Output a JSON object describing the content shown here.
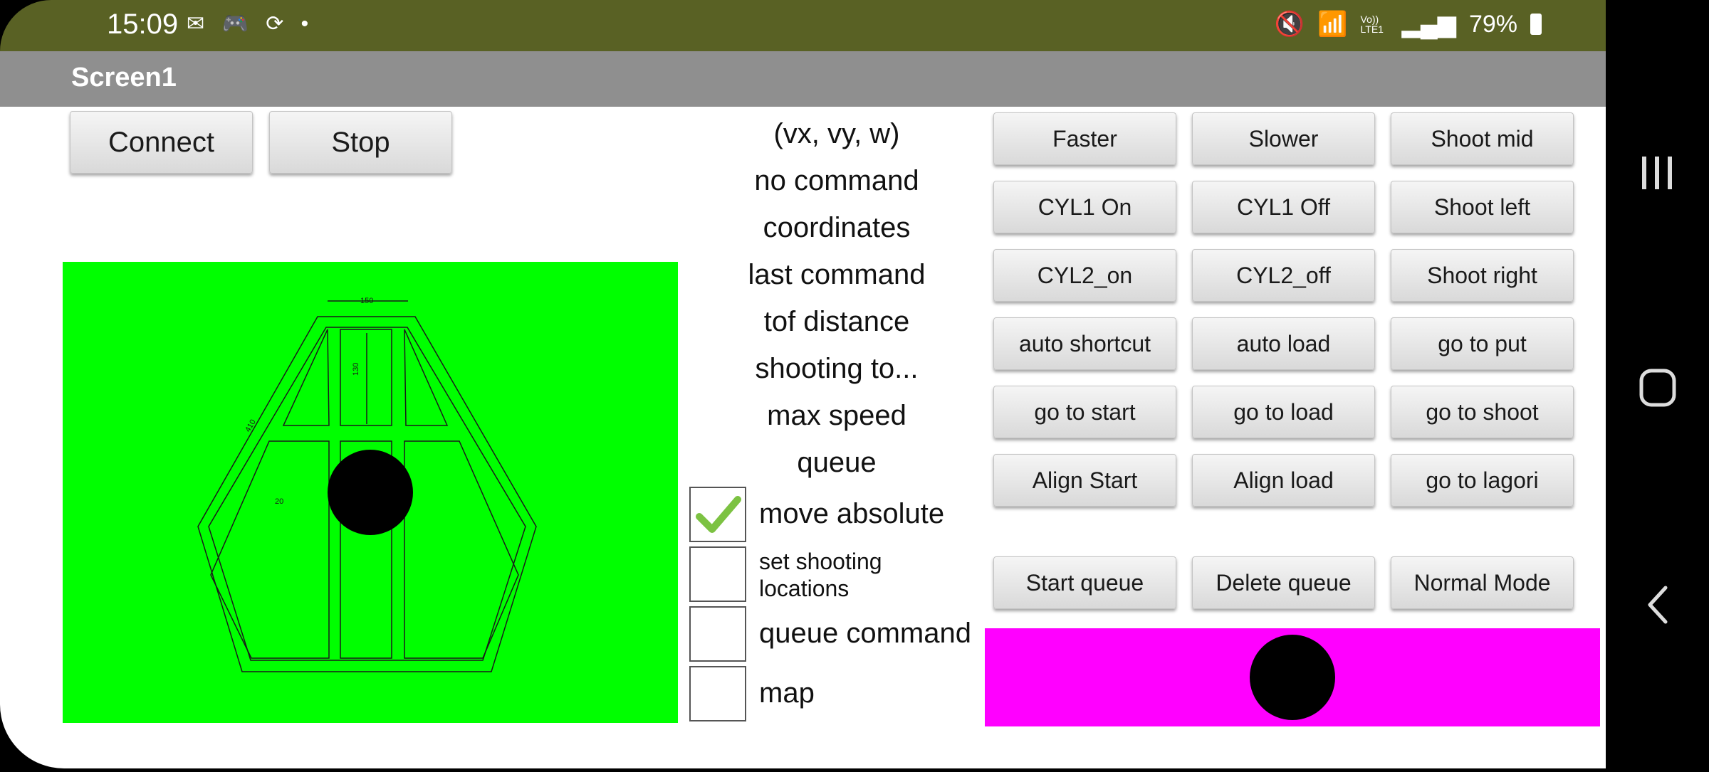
{
  "status_bar": {
    "time": "15:09",
    "left_icons": [
      "mail-icon",
      "game-icon",
      "sync-icon",
      "dot-icon"
    ],
    "right_icons": [
      "mute-icon",
      "wifi-icon",
      "volte-icon",
      "signal-icon"
    ],
    "volte_label": "Vo)) LTE1",
    "battery": "79%",
    "color": "#596124"
  },
  "app": {
    "title": "Screen1",
    "titlebar_color": "#8f8f8f"
  },
  "left_buttons": {
    "connect": "Connect",
    "stop": "Stop"
  },
  "center": {
    "labels": [
      "(vx, vy, w)",
      "no command",
      "coordinates",
      "last command",
      "tof distance",
      "shooting to...",
      "max speed",
      "queue"
    ],
    "checkboxes": [
      {
        "label": "move absolute",
        "checked": true
      },
      {
        "label": "set shooting locations",
        "checked": false
      },
      {
        "label": "queue command",
        "checked": false
      },
      {
        "label": "map",
        "checked": false
      }
    ]
  },
  "grid_buttons": [
    [
      "Faster",
      "Slower",
      "Shoot mid"
    ],
    [
      "CYL1 On",
      "CYL1 Off",
      "Shoot left"
    ],
    [
      "CYL2_on",
      "CYL2_off",
      "Shoot right"
    ],
    [
      "auto shortcut",
      "auto load",
      "go to put"
    ],
    [
      "go to start",
      "go to load",
      "go to shoot"
    ],
    [
      "Align Start",
      "Align load",
      "go to lagori"
    ]
  ],
  "queue_buttons": [
    "Start queue",
    "Delete queue",
    "Normal Mode"
  ],
  "map": {
    "background": "#00ff00",
    "dimension_labels": {
      "top": "150",
      "vertical": "130",
      "side": "410",
      "small": "20"
    }
  },
  "joystick": {
    "background": "#ff00ff"
  },
  "navigation": {
    "icons": [
      "recent-apps-icon",
      "home-icon",
      "back-icon"
    ]
  }
}
